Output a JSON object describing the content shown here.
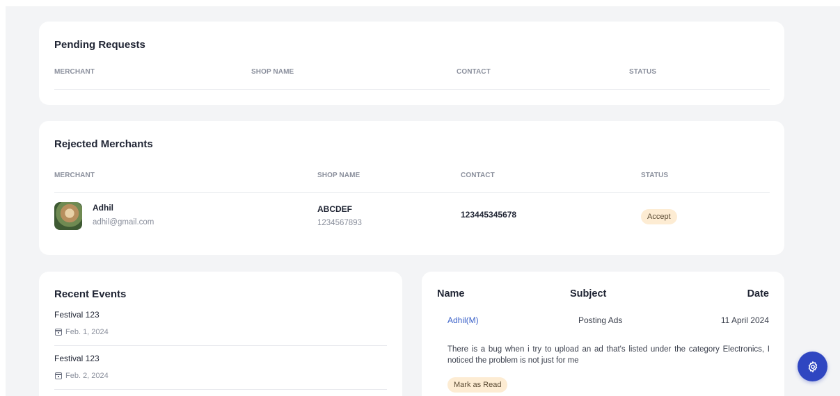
{
  "pending": {
    "title": "Pending Requests",
    "columns": [
      "MERCHANT",
      "SHOP NAME",
      "CONTACT",
      "STATUS"
    ]
  },
  "rejected": {
    "title": "Rejected Merchants",
    "columns": [
      "MERCHANT",
      "SHOP NAME",
      "CONTACT",
      "STATUS"
    ],
    "rows": [
      {
        "name": "Adhil",
        "email": "adhil@gmail.com",
        "shop_name": "ABCDEF",
        "shop_phone": "1234567893",
        "contact": "123445345678",
        "status_action": "Accept"
      }
    ]
  },
  "events": {
    "title": "Recent Events",
    "items": [
      {
        "title": "Festival 123",
        "date": "Feb. 1, 2024"
      },
      {
        "title": "Festival 123",
        "date": "Feb. 2, 2024"
      }
    ]
  },
  "messages": {
    "columns": {
      "name": "Name",
      "subject": "Subject",
      "date": "Date"
    },
    "items": [
      {
        "name": "Adhil(M)",
        "subject": "Posting Ads",
        "date": "11 April 2024",
        "body": "There is a bug when i try to upload an ad that's listed under the category Electronics, I noticed the problem is not just for me",
        "action": "Mark as Read"
      }
    ]
  },
  "fab": {
    "icon": "gear-icon",
    "color": "#2f46c1"
  },
  "colors": {
    "background": "#f3f4f6",
    "badge": "#fdecd3",
    "link": "#3d63c9"
  }
}
